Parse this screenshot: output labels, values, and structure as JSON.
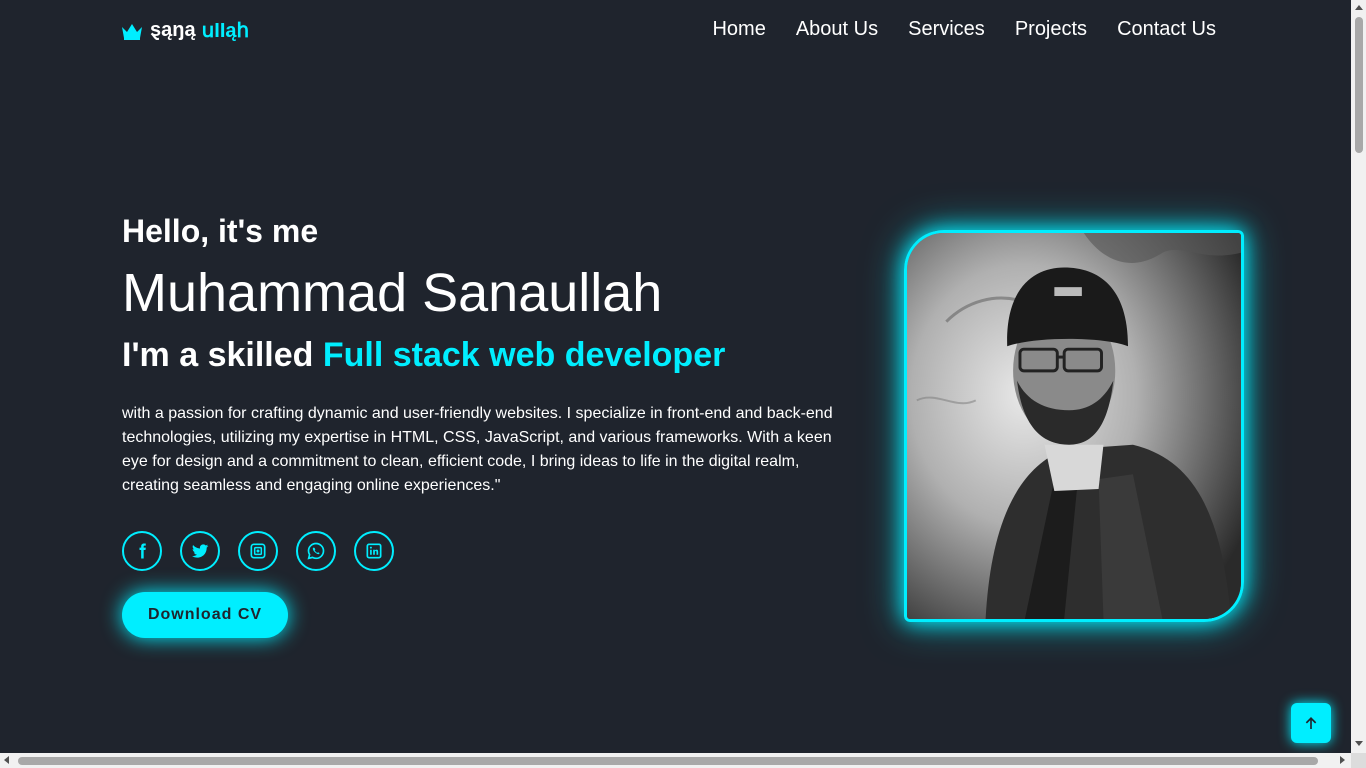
{
  "header": {
    "logo_first": "ȿąŋą",
    "logo_second": " սӀӀąհ",
    "nav": [
      "Home",
      "About Us",
      "Services",
      "Projects",
      "Contact Us"
    ]
  },
  "hero": {
    "greeting": "Hello, it's me",
    "name": "Muhammad Sanaullah",
    "role_prefix": "I'm a skilled ",
    "role_accent": "Full stack web developer",
    "bio": "with a passion for crafting dynamic and user-friendly websites. I specialize in front-end and back-end technologies, utilizing my expertise in HTML, CSS, JavaScript, and various frameworks. With a keen eye for design and a commitment to clean, efficient code, I bring ideas to life in the digital realm, creating seamless and engaging online experiences.\"",
    "socials": [
      "facebook-icon",
      "twitter-icon",
      "instagram-icon",
      "whatsapp-icon",
      "linkedin-icon"
    ],
    "cv_button": "Download CV"
  },
  "colors": {
    "background": "#1f242d",
    "accent": "#00eeff",
    "text": "#ffffff"
  },
  "icons": {
    "logo": "crown-icon",
    "back_to_top": "arrow-up-icon"
  }
}
